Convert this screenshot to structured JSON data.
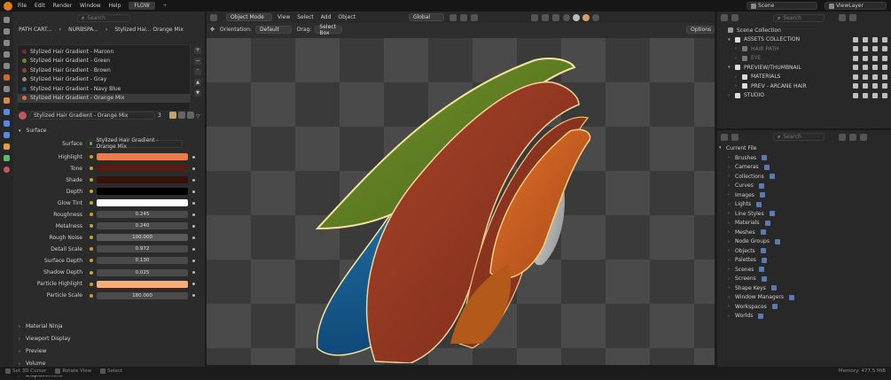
{
  "menubar": {
    "items": [
      "File",
      "Edit",
      "Render",
      "Window",
      "Help"
    ],
    "active_tab": "FLOW",
    "scene": "Scene",
    "view_layer": "ViewLayer"
  },
  "props": {
    "search_placeholder": "Search",
    "breadcrumb": [
      "PATH CART...",
      "NURBSPA...",
      "Stylized Hai... Orange Mix"
    ],
    "materials": [
      {
        "label": "Stylized Hair Gradient - Maroon",
        "color": "#7a2a2a"
      },
      {
        "label": "Stylized Hair Gradient - Green",
        "color": "#6a8a2a"
      },
      {
        "label": "Stylized Hair Gradient - Brown",
        "color": "#8a4a2a"
      },
      {
        "label": "Stylized Hair Gradient - Gray",
        "color": "#8a8a8a"
      },
      {
        "label": "Stylized Hair Gradient - Navy Blue",
        "color": "#2a5a8a"
      },
      {
        "label": "Stylized Hair Gradient - Orange Mix",
        "color": "#e0702a"
      }
    ],
    "material_field": "Stylized Hair Gradient - Orange Mix",
    "user_count": "3",
    "surface_section": "Surface",
    "surface_label": "Surface",
    "surface_value": "Stylized Hair Gradient - Orange Mix",
    "rows": [
      {
        "label": "Highlight",
        "value": "",
        "color": "#f07a45"
      },
      {
        "label": "Tone",
        "value": "",
        "color": "#5a1a14"
      },
      {
        "label": "Shade",
        "value": "",
        "color": "#3a100c"
      },
      {
        "label": "Depth",
        "value": "",
        "color": "#000000"
      },
      {
        "label": "Glow Tint",
        "value": "",
        "color": "#ffffff"
      },
      {
        "label": "Roughness",
        "value": "0.245",
        "color": "#4a4a4a"
      },
      {
        "label": "Metalness",
        "value": "0.240",
        "color": "#4a4a4a"
      },
      {
        "label": "Rough Noise",
        "value": "100.000",
        "color": "#5a5a5a"
      },
      {
        "label": "Detail Scale",
        "value": "0.972",
        "color": "#4a4a4a"
      },
      {
        "label": "Surface Depth",
        "value": "0.130",
        "color": "#4a4a4a"
      },
      {
        "label": "Shadow Depth",
        "value": "0.025",
        "color": "#4a4a4a"
      },
      {
        "label": "Particle Highlight",
        "value": "",
        "color": "#f9ad74"
      },
      {
        "label": "Particle Scale",
        "value": "180.000",
        "color": "#4a4a4a"
      }
    ],
    "collapsed_sections": [
      "Material Ninja",
      "Viewport Display",
      "Preview",
      "Volume",
      "Displacement"
    ]
  },
  "viewport": {
    "mode": "Object Mode",
    "menu": [
      "View",
      "Select",
      "Add",
      "Object"
    ],
    "transform": "Global",
    "orientation_label": "Orientation:",
    "orientation_value": "Default",
    "drag_label": "Drag:",
    "drag_value": "Select Box",
    "options": "Options"
  },
  "outliner": {
    "search_placeholder": "Search",
    "rows": [
      {
        "label": "Scene Collection",
        "indent": 0,
        "arrow": "",
        "icon_color": "#9a9a9a"
      },
      {
        "label": "ASSETS COLLECTION",
        "indent": 1,
        "arrow": "▾",
        "icon_color": "#dddddd"
      },
      {
        "label": "HAIR PATH",
        "indent": 2,
        "arrow": "›",
        "icon_color": "#777777"
      },
      {
        "label": "EYE",
        "indent": 2,
        "arrow": "›",
        "icon_color": "#777777"
      },
      {
        "label": "PREVIEW/THUMBNAIL",
        "indent": 1,
        "arrow": "▾",
        "icon_color": "#dddddd"
      },
      {
        "label": "MATERIALS",
        "indent": 2,
        "arrow": "›",
        "icon_color": "#dddddd"
      },
      {
        "label": "PREV - ARCANE HAIR",
        "indent": 2,
        "arrow": "›",
        "icon_color": "#dddddd"
      },
      {
        "label": "STUDIO",
        "indent": 1,
        "arrow": "›",
        "icon_color": "#dddddd"
      }
    ]
  },
  "datablocks": {
    "search_placeholder": "Search",
    "title": "Current File",
    "items": [
      "Brushes",
      "Cameras",
      "Collections",
      "Curves",
      "Images",
      "Lights",
      "Line Styles",
      "Materials",
      "Meshes",
      "Node Groups",
      "Objects",
      "Palettes",
      "Scenes",
      "Screens",
      "Shape Keys",
      "Window Managers",
      "Workspaces",
      "Worlds"
    ]
  },
  "statusbar": {
    "left": [
      "Set 3D Cursor",
      "Rotate View",
      "Select"
    ],
    "right": "Memory: 477.5 MiB"
  }
}
